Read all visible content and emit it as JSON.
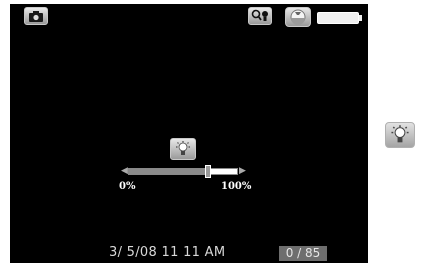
{
  "toolbar": {
    "camera_icon": "camera-icon",
    "light_search_icon": "magnifier-bulb-icon",
    "globe_icon": "globe-icon",
    "battery_icon": "battery-icon"
  },
  "brightness": {
    "icon": "lightbulb-icon",
    "min_label": "0%",
    "max_label": "100%",
    "value_fraction": 0.73
  },
  "status": {
    "datetime": "3/ 5/08 11 11 AM",
    "counter": "0 / 85"
  },
  "side": {
    "icon": "lightbulb-icon"
  },
  "colors": {
    "screen": "#000000",
    "accent_gray": "#6e6e6e"
  }
}
